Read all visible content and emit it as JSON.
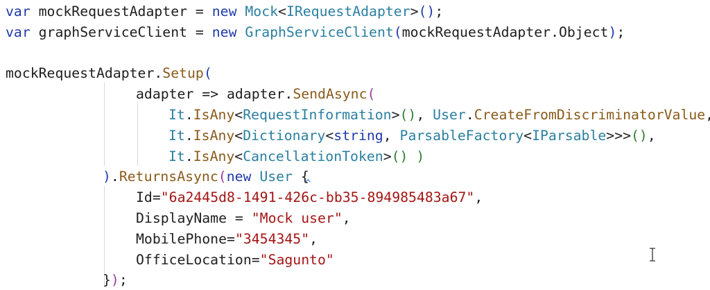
{
  "editor": {
    "lines": [
      {
        "indent": 8,
        "tokens": [
          {
            "t": "var",
            "c": "kw"
          },
          {
            "t": " mockRequestAdapter ",
            "c": "id"
          },
          {
            "t": "=",
            "c": "pun"
          },
          {
            "t": " new ",
            "c": "kw"
          },
          {
            "t": "Mock",
            "c": "typ"
          },
          {
            "t": "<",
            "c": "pun"
          },
          {
            "t": "IRequestAdapter",
            "c": "typ"
          },
          {
            "t": ">",
            "c": "pun"
          },
          {
            "t": "()",
            "c": "par"
          },
          {
            "t": ";",
            "c": "pun"
          }
        ]
      },
      {
        "indent": 8,
        "tokens": [
          {
            "t": "var",
            "c": "kw"
          },
          {
            "t": " graphServiceClient ",
            "c": "id"
          },
          {
            "t": "=",
            "c": "pun"
          },
          {
            "t": " new ",
            "c": "kw"
          },
          {
            "t": "GraphServiceClient",
            "c": "typ"
          },
          {
            "t": "(",
            "c": "par"
          },
          {
            "t": "mockRequestAdapter",
            "c": "id"
          },
          {
            "t": ".",
            "c": "pun"
          },
          {
            "t": "Object",
            "c": "id"
          },
          {
            "t": ")",
            "c": "par"
          },
          {
            "t": ";",
            "c": "pun"
          }
        ]
      },
      {
        "indent": 8,
        "tokens": []
      },
      {
        "indent": 8,
        "tokens": [
          {
            "t": "mockRequestAdapter",
            "c": "id"
          },
          {
            "t": ".",
            "c": "pun"
          },
          {
            "t": "Setup",
            "c": "fn"
          },
          {
            "t": "(",
            "c": "par"
          }
        ]
      },
      {
        "indent": 196,
        "tokens": [
          {
            "t": "adapter",
            "c": "id"
          },
          {
            "t": " => ",
            "c": "pun"
          },
          {
            "t": "adapter",
            "c": "id"
          },
          {
            "t": ".",
            "c": "pun"
          },
          {
            "t": "SendAsync",
            "c": "fn"
          },
          {
            "t": "(",
            "c": "par2"
          }
        ]
      },
      {
        "indent": 243,
        "tokens": [
          {
            "t": "It",
            "c": "typ"
          },
          {
            "t": ".",
            "c": "pun"
          },
          {
            "t": "IsAny",
            "c": "fn"
          },
          {
            "t": "<",
            "c": "pun"
          },
          {
            "t": "RequestInformation",
            "c": "typ"
          },
          {
            "t": ">",
            "c": "pun"
          },
          {
            "t": "()",
            "c": "par3"
          },
          {
            "t": ", ",
            "c": "pun"
          },
          {
            "t": "User",
            "c": "typ"
          },
          {
            "t": ".",
            "c": "pun"
          },
          {
            "t": "CreateFromDiscriminatorValue",
            "c": "fn"
          },
          {
            "t": ",",
            "c": "pun"
          }
        ]
      },
      {
        "indent": 243,
        "tokens": [
          {
            "t": "It",
            "c": "typ"
          },
          {
            "t": ".",
            "c": "pun"
          },
          {
            "t": "IsAny",
            "c": "fn"
          },
          {
            "t": "<",
            "c": "pun"
          },
          {
            "t": "Dictionary",
            "c": "typ"
          },
          {
            "t": "<",
            "c": "pun"
          },
          {
            "t": "string",
            "c": "kw"
          },
          {
            "t": ", ",
            "c": "pun"
          },
          {
            "t": "ParsableFactory",
            "c": "typ"
          },
          {
            "t": "<",
            "c": "pun"
          },
          {
            "t": "IParsable",
            "c": "typ"
          },
          {
            "t": ">>>",
            "c": "pun"
          },
          {
            "t": "()",
            "c": "par3"
          },
          {
            "t": ",",
            "c": "pun"
          }
        ]
      },
      {
        "indent": 243,
        "tokens": [
          {
            "t": "It",
            "c": "typ"
          },
          {
            "t": ".",
            "c": "pun"
          },
          {
            "t": "IsAny",
            "c": "fn"
          },
          {
            "t": "<",
            "c": "pun"
          },
          {
            "t": "CancellationToken",
            "c": "typ"
          },
          {
            "t": ">",
            "c": "pun"
          },
          {
            "t": "()",
            "c": "par3"
          },
          {
            "t": " ",
            "c": "pun"
          },
          {
            "t": ")",
            "c": "par3"
          }
        ]
      },
      {
        "indent": 148,
        "tokens": [
          {
            "t": ")",
            "c": "par"
          },
          {
            "t": ".",
            "c": "pun"
          },
          {
            "t": "ReturnsAsync",
            "c": "fn"
          },
          {
            "t": "(",
            "c": "par2"
          },
          {
            "t": "new ",
            "c": "kw"
          },
          {
            "t": "User",
            "c": "typ"
          },
          {
            "t": " {",
            "c": "pun"
          }
        ]
      },
      {
        "indent": 196,
        "tokens": [
          {
            "t": "Id",
            "c": "id"
          },
          {
            "t": "=",
            "c": "pun"
          },
          {
            "t": "\"6a2445d8-1491-426c-bb35-894985483a67\"",
            "c": "str"
          },
          {
            "t": ",",
            "c": "pun"
          }
        ]
      },
      {
        "indent": 196,
        "tokens": [
          {
            "t": "DisplayName",
            "c": "id"
          },
          {
            "t": " = ",
            "c": "pun"
          },
          {
            "t": "\"Mock user\"",
            "c": "str"
          },
          {
            "t": ",",
            "c": "pun"
          }
        ]
      },
      {
        "indent": 196,
        "tokens": [
          {
            "t": "MobilePhone",
            "c": "id"
          },
          {
            "t": "=",
            "c": "pun"
          },
          {
            "t": "\"3454345\"",
            "c": "str"
          },
          {
            "t": ",",
            "c": "pun"
          }
        ]
      },
      {
        "indent": 196,
        "tokens": [
          {
            "t": "OfficeLocation",
            "c": "id"
          },
          {
            "t": "=",
            "c": "pun"
          },
          {
            "t": "\"Sagunto\"",
            "c": "str"
          }
        ]
      },
      {
        "indent": 148,
        "tokens": [
          {
            "t": "}",
            "c": "pun"
          },
          {
            "t": ")",
            "c": "par2"
          },
          {
            "t": ";",
            "c": "pun"
          }
        ]
      }
    ]
  }
}
